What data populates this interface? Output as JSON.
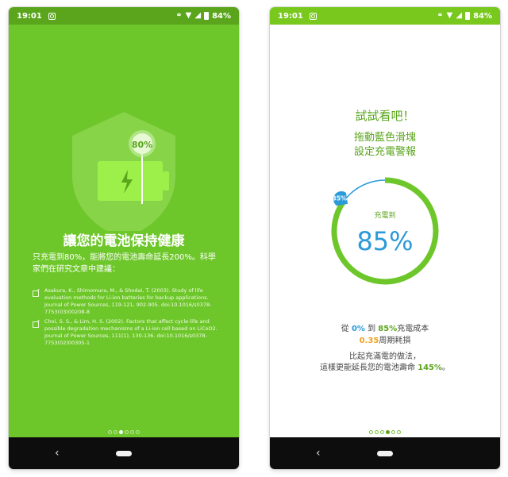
{
  "status": {
    "time": "19:01",
    "battery": "84%",
    "icons": [
      "instagram-icon",
      "link-icon",
      "wifi-icon",
      "signal-icon",
      "battery-icon"
    ]
  },
  "left": {
    "badge": "80%",
    "title": "讓您的電池保持健康",
    "body": "只充電到80%，能將您的電池壽命延長200%。科學家們在研究文章中建議：",
    "references": [
      "Asakura, K., Shimomura, M., & Shodai, T. (2003). Study of life evaluation methods for Li-ion batteries for backup applications. Journal of Power Sources, 119-121, 902-905. doi:10.1016/s0378-7753(03)00208-8",
      "Choi, S. S., & Lim, H. S. (2002). Factors that affect cycle-life and possible degradation mechanisms of a Li-ion cell based on LiCoO2. Journal of Power Sources, 111(1), 130-136. doi:10.1016/s0378-7753(02)00305-1"
    ],
    "page_count": 6,
    "active_page": 2
  },
  "right": {
    "title": "試試看吧！",
    "line1": "拖動藍色滑塊",
    "line2": "設定充電警報",
    "gauge": {
      "label": "充電到",
      "value": "85%",
      "handle": "85%",
      "fraction": 0.85
    },
    "cost": {
      "from": "從",
      "start": "0%",
      "to": "到",
      "end": "85%",
      "suffix": "充電成本",
      "cycles": "0.35",
      "cycles_suffix": "周期耗損"
    },
    "compare": {
      "line1": "比起充滿電的做法，",
      "line2a": "這樣更能延長您的電池壽命",
      "percent": "145%",
      "tail": "。"
    },
    "page_count": 6,
    "active_page": 4
  },
  "colors": {
    "green": "#6ec72a",
    "dark_green": "#5aa51c",
    "blue": "#2a9ad8",
    "orange": "#f0a020"
  }
}
